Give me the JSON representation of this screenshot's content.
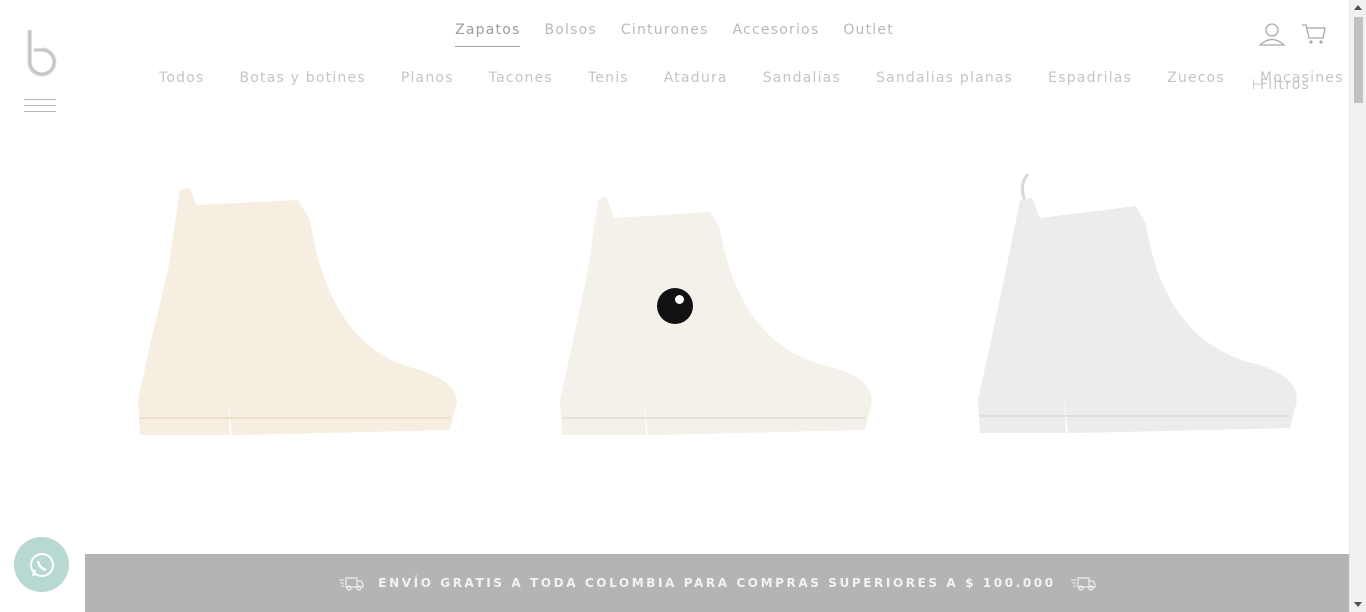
{
  "brand": {
    "logo_icon": "brand-b-logo"
  },
  "menu": {
    "icon": "hamburger-icon"
  },
  "top_nav": [
    {
      "label": "Zapatos",
      "active": true
    },
    {
      "label": "Bolsos",
      "active": false
    },
    {
      "label": "Cinturones",
      "active": false
    },
    {
      "label": "Accesorios",
      "active": false
    },
    {
      "label": "Outlet",
      "active": false
    }
  ],
  "header_icons": {
    "account": "user-icon",
    "cart": "cart-icon"
  },
  "sub_nav": [
    {
      "label": "Todos"
    },
    {
      "label": "Botas y botines"
    },
    {
      "label": "Planos"
    },
    {
      "label": "Tacones"
    },
    {
      "label": "Tenis"
    },
    {
      "label": "Atadura"
    },
    {
      "label": "Sandalias"
    },
    {
      "label": "Sandalias planas"
    },
    {
      "label": "Espadrilas"
    },
    {
      "label": "Zuecos"
    },
    {
      "label": "Mocasines"
    }
  ],
  "filters": {
    "label": "Filtros"
  },
  "products": [
    {
      "color": "#f6eee1"
    },
    {
      "color": "#f4f1ea"
    },
    {
      "color": "#ececec"
    }
  ],
  "banner": {
    "text": "ENVÍO GRATIS A TODA COLOMBIA PARA COMPRAS SUPERIORES A $ 100.000"
  },
  "colors": {
    "banner_bg": "#b4b4b4",
    "whatsapp_bg": "#b8d8d3"
  }
}
